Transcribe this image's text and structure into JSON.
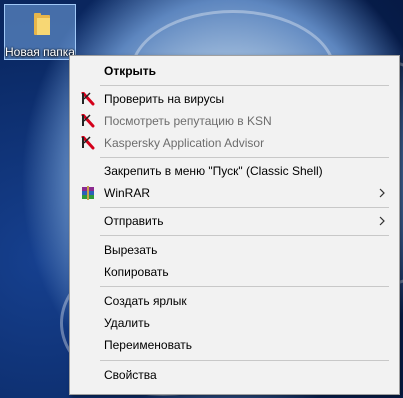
{
  "desktop": {
    "icon_label": "Новая папка"
  },
  "menu": {
    "items": [
      {
        "label": "Открыть"
      },
      {
        "label": "Проверить на вирусы"
      },
      {
        "label": "Посмотреть репутацию в KSN"
      },
      {
        "label": "Kaspersky Application Advisor"
      },
      {
        "label": "Закрепить в меню \"Пуск\" (Classic Shell)"
      },
      {
        "label": "WinRAR"
      },
      {
        "label": "Отправить"
      },
      {
        "label": "Вырезать"
      },
      {
        "label": "Копировать"
      },
      {
        "label": "Создать ярлык"
      },
      {
        "label": "Удалить"
      },
      {
        "label": "Переименовать"
      },
      {
        "label": "Свойства"
      }
    ]
  },
  "icons": {
    "kaspersky": "kaspersky-icon",
    "winrar": "winrar-icon",
    "submenu": "chevron-right-icon",
    "folder": "folder-icon"
  },
  "colors": {
    "menu_bg": "#f2f2f2",
    "separator": "#c8c8c8",
    "disabled_text": "#6d6d6d",
    "kaspersky_red": "#d4001a",
    "selection_bg": "#78aae6"
  }
}
